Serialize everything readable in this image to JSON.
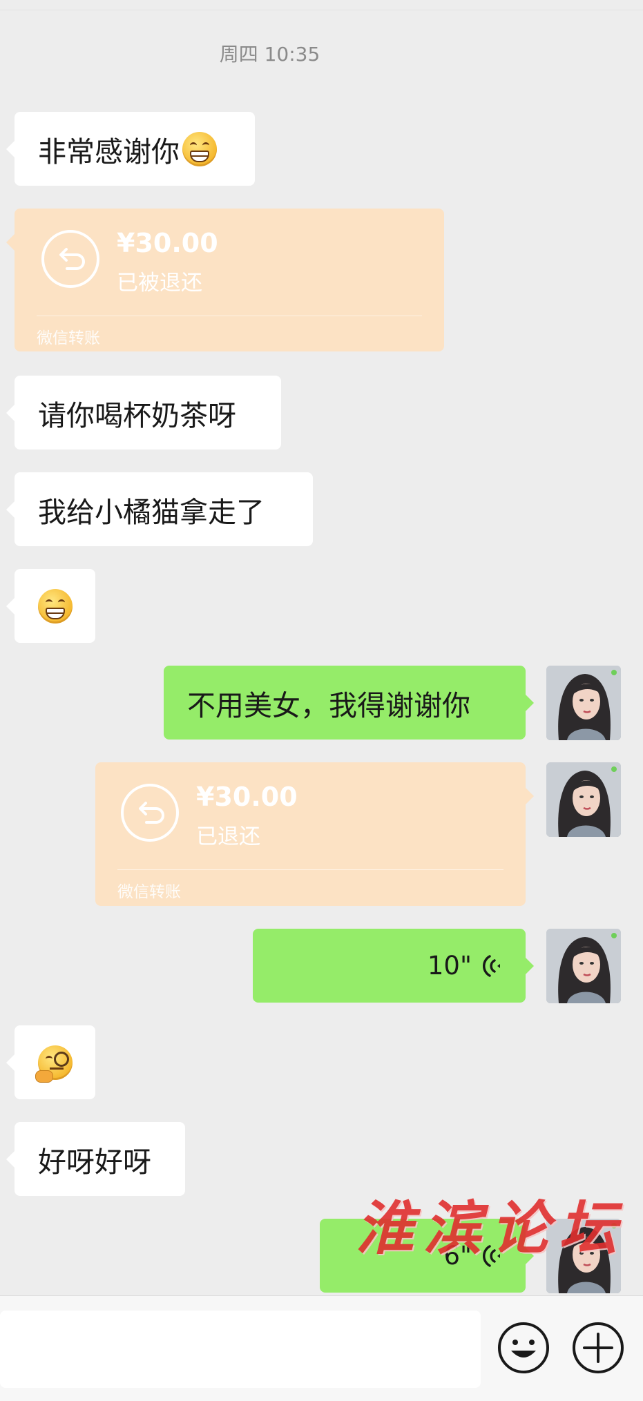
{
  "timestamp": "周四 10:35",
  "messages": {
    "m1": "非常感谢你",
    "m3": "请你喝杯奶茶呀",
    "m4": "我给小橘猫拿走了",
    "m6": "不用美女，我得谢谢你",
    "m10": "好呀好呀"
  },
  "transfer_in": {
    "amount": "¥30.00",
    "status": "已被退还",
    "brand": "微信转账"
  },
  "transfer_out": {
    "amount": "¥30.00",
    "status": "已退还",
    "brand": "微信转账"
  },
  "voice1": {
    "duration": "10\""
  },
  "voice2": {
    "duration": "6\""
  },
  "watermark": "淮滨论坛",
  "icons": {
    "emoji_grin": "grinning-face-icon",
    "emoji_think": "thinking-face-icon",
    "transfer": "return-arrow-icon",
    "voice": "voice-wave-icon",
    "input_emoji": "smiley-icon",
    "input_more": "plus-circle-icon"
  },
  "colors": {
    "background": "#ededed",
    "bubble_in": "#ffffff",
    "bubble_out": "#95ec69",
    "transfer": "#fce2c4",
    "watermark": "#e02f2f"
  }
}
